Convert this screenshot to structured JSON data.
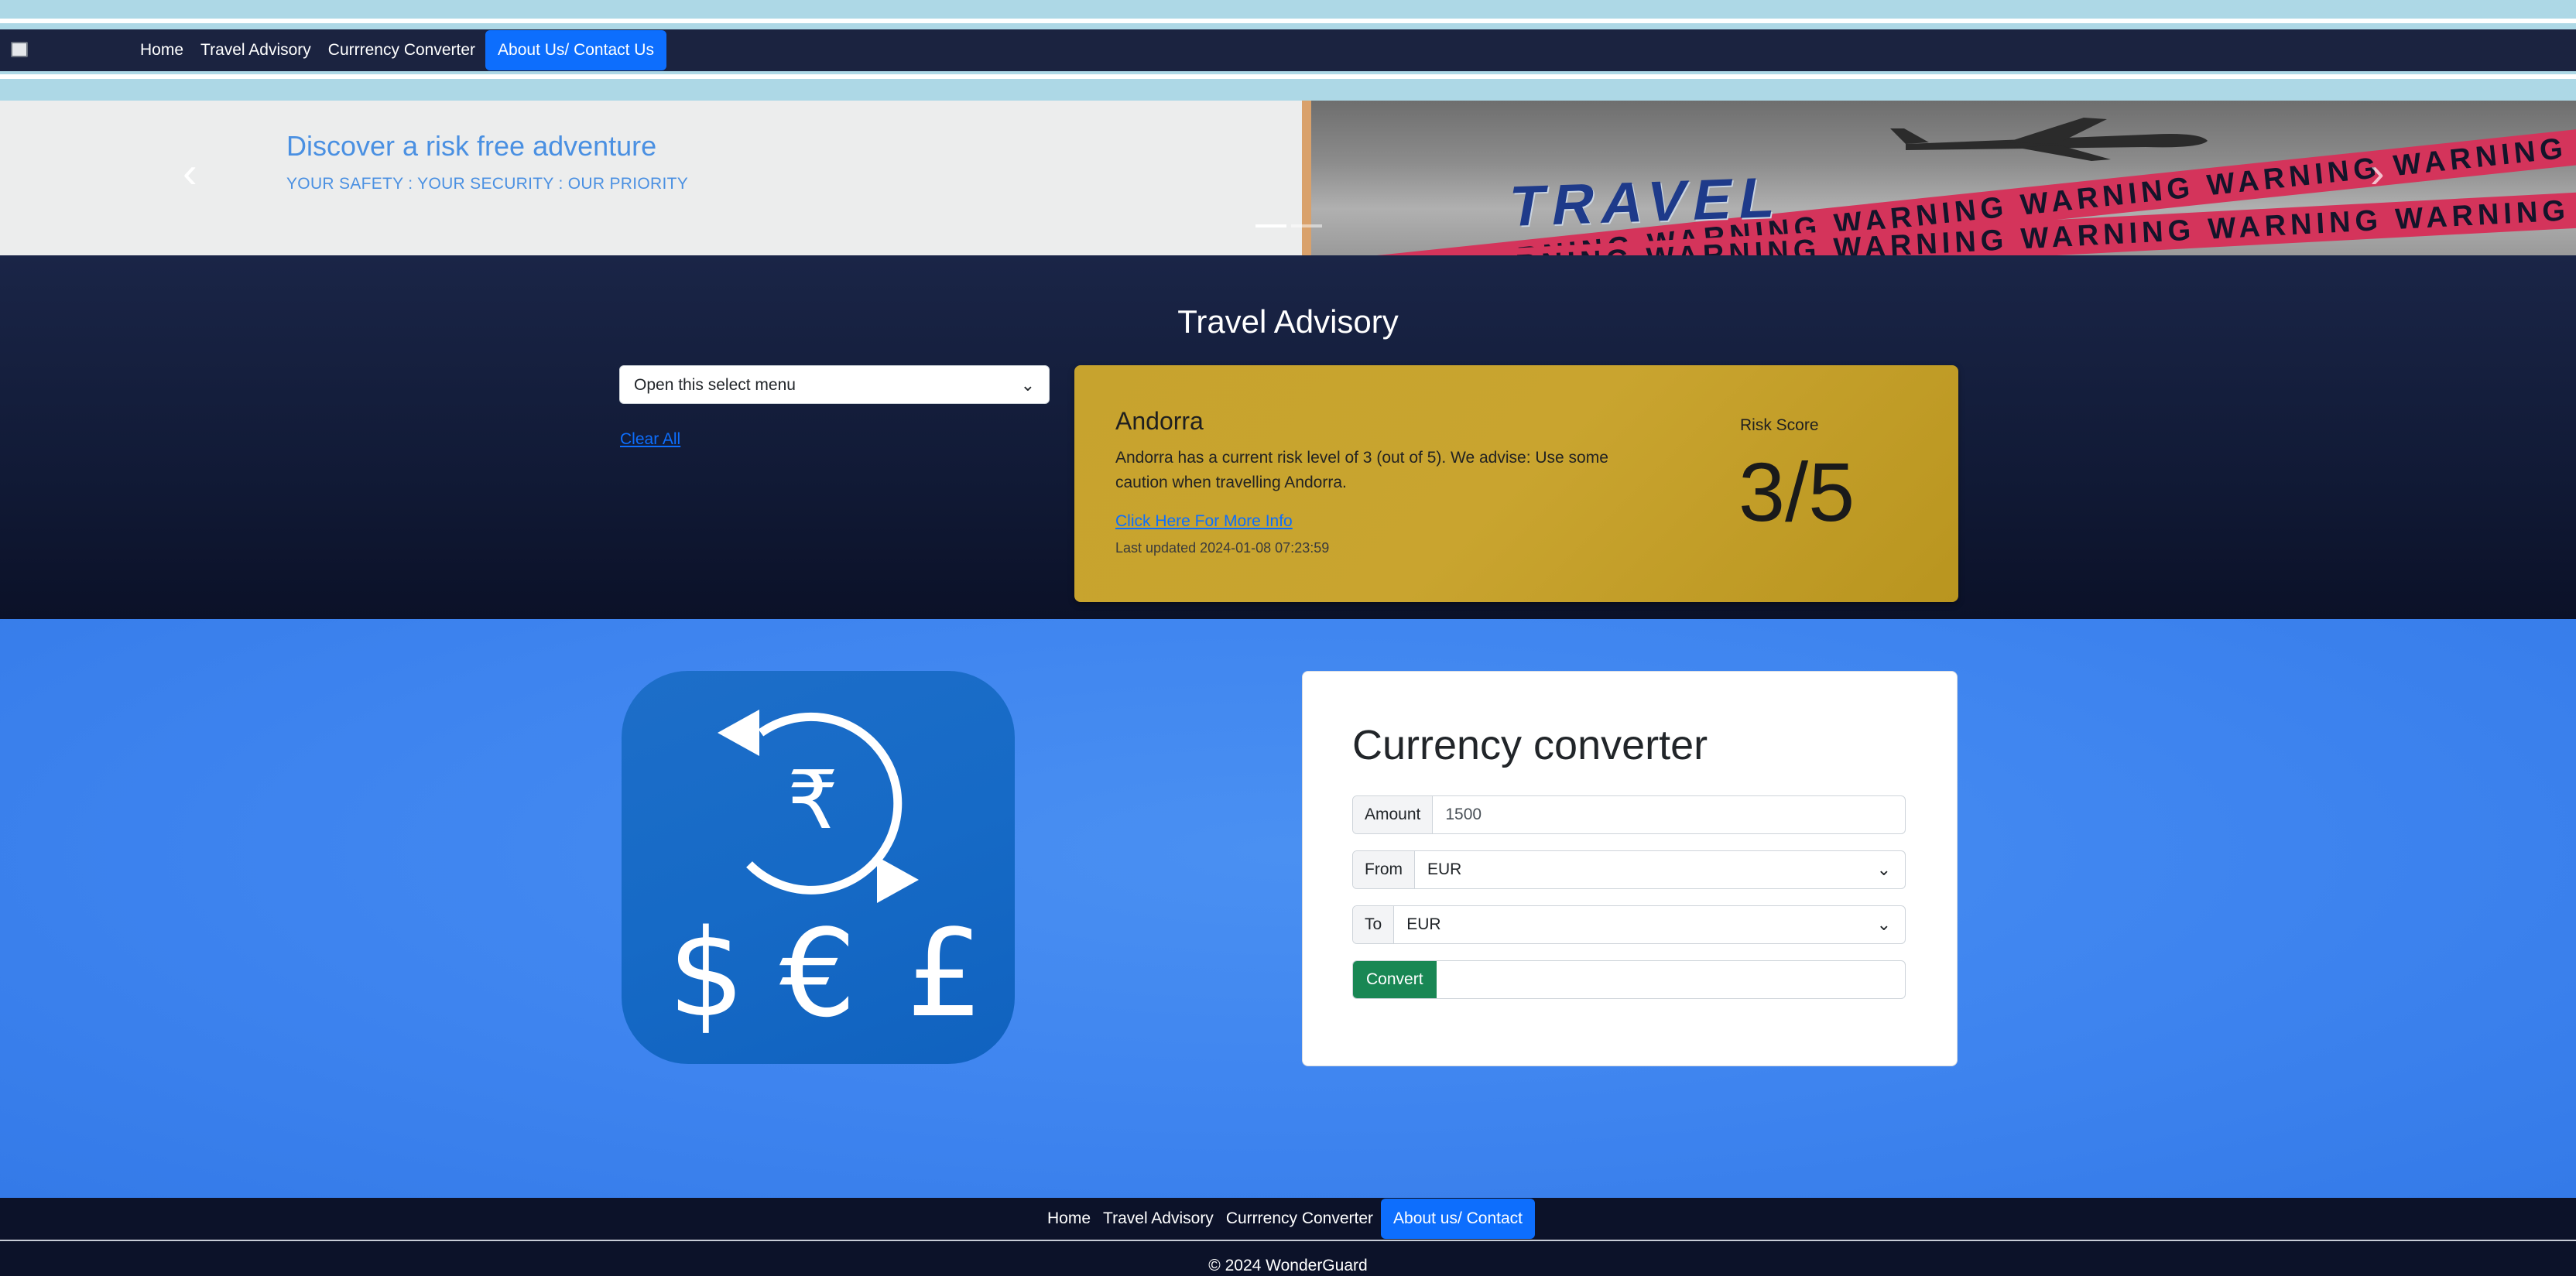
{
  "nav": {
    "items": [
      {
        "label": "Home"
      },
      {
        "label": "Travel Advisory"
      },
      {
        "label": "Currrency Converter"
      },
      {
        "label": "About Us/ Contact Us"
      }
    ]
  },
  "hero": {
    "title": "Discover a risk free adventure",
    "subtitle": "YOUR SAFETY : YOUR SECURITY : OUR PRIORITY",
    "image_word": "TRAVEL",
    "tape_text": "WARNING WARNING WARNING WARNING WARNING WARNING WARNING WARNING"
  },
  "advisory": {
    "title": "Travel Advisory",
    "select_placeholder": "Open this select menu",
    "clear_label": "Clear All",
    "card": {
      "country": "Andorra",
      "message": "Andorra has a current risk level of 3 (out of 5). We advise: Use some caution when travelling Andorra.",
      "link_label": "Click Here For More Info",
      "updated": "Last updated 2024-01-08 07:23:59",
      "risk_label": "Risk Score",
      "risk_value": "3/5",
      "color": "#c7a32e"
    }
  },
  "converter": {
    "icon_symbols": [
      "$",
      "€",
      "£"
    ],
    "icon_center_symbol": "₹",
    "title": "Currency converter",
    "amount_label": "Amount",
    "amount_value": "1500",
    "from_label": "From",
    "from_value": "EUR",
    "to_label": "To",
    "to_value": "EUR",
    "convert_label": "Convert",
    "result": ""
  },
  "footer": {
    "items": [
      {
        "label": "Home"
      },
      {
        "label": "Travel Advisory"
      },
      {
        "label": "Currrency Converter"
      },
      {
        "label": "About us/ Contact"
      }
    ],
    "copyright": "© 2024 WonderGuard"
  },
  "colors": {
    "navbar": "#1b2340",
    "accent": "#0d6efd",
    "converter_bg": "#3e84ef",
    "convert_button": "#198754"
  }
}
